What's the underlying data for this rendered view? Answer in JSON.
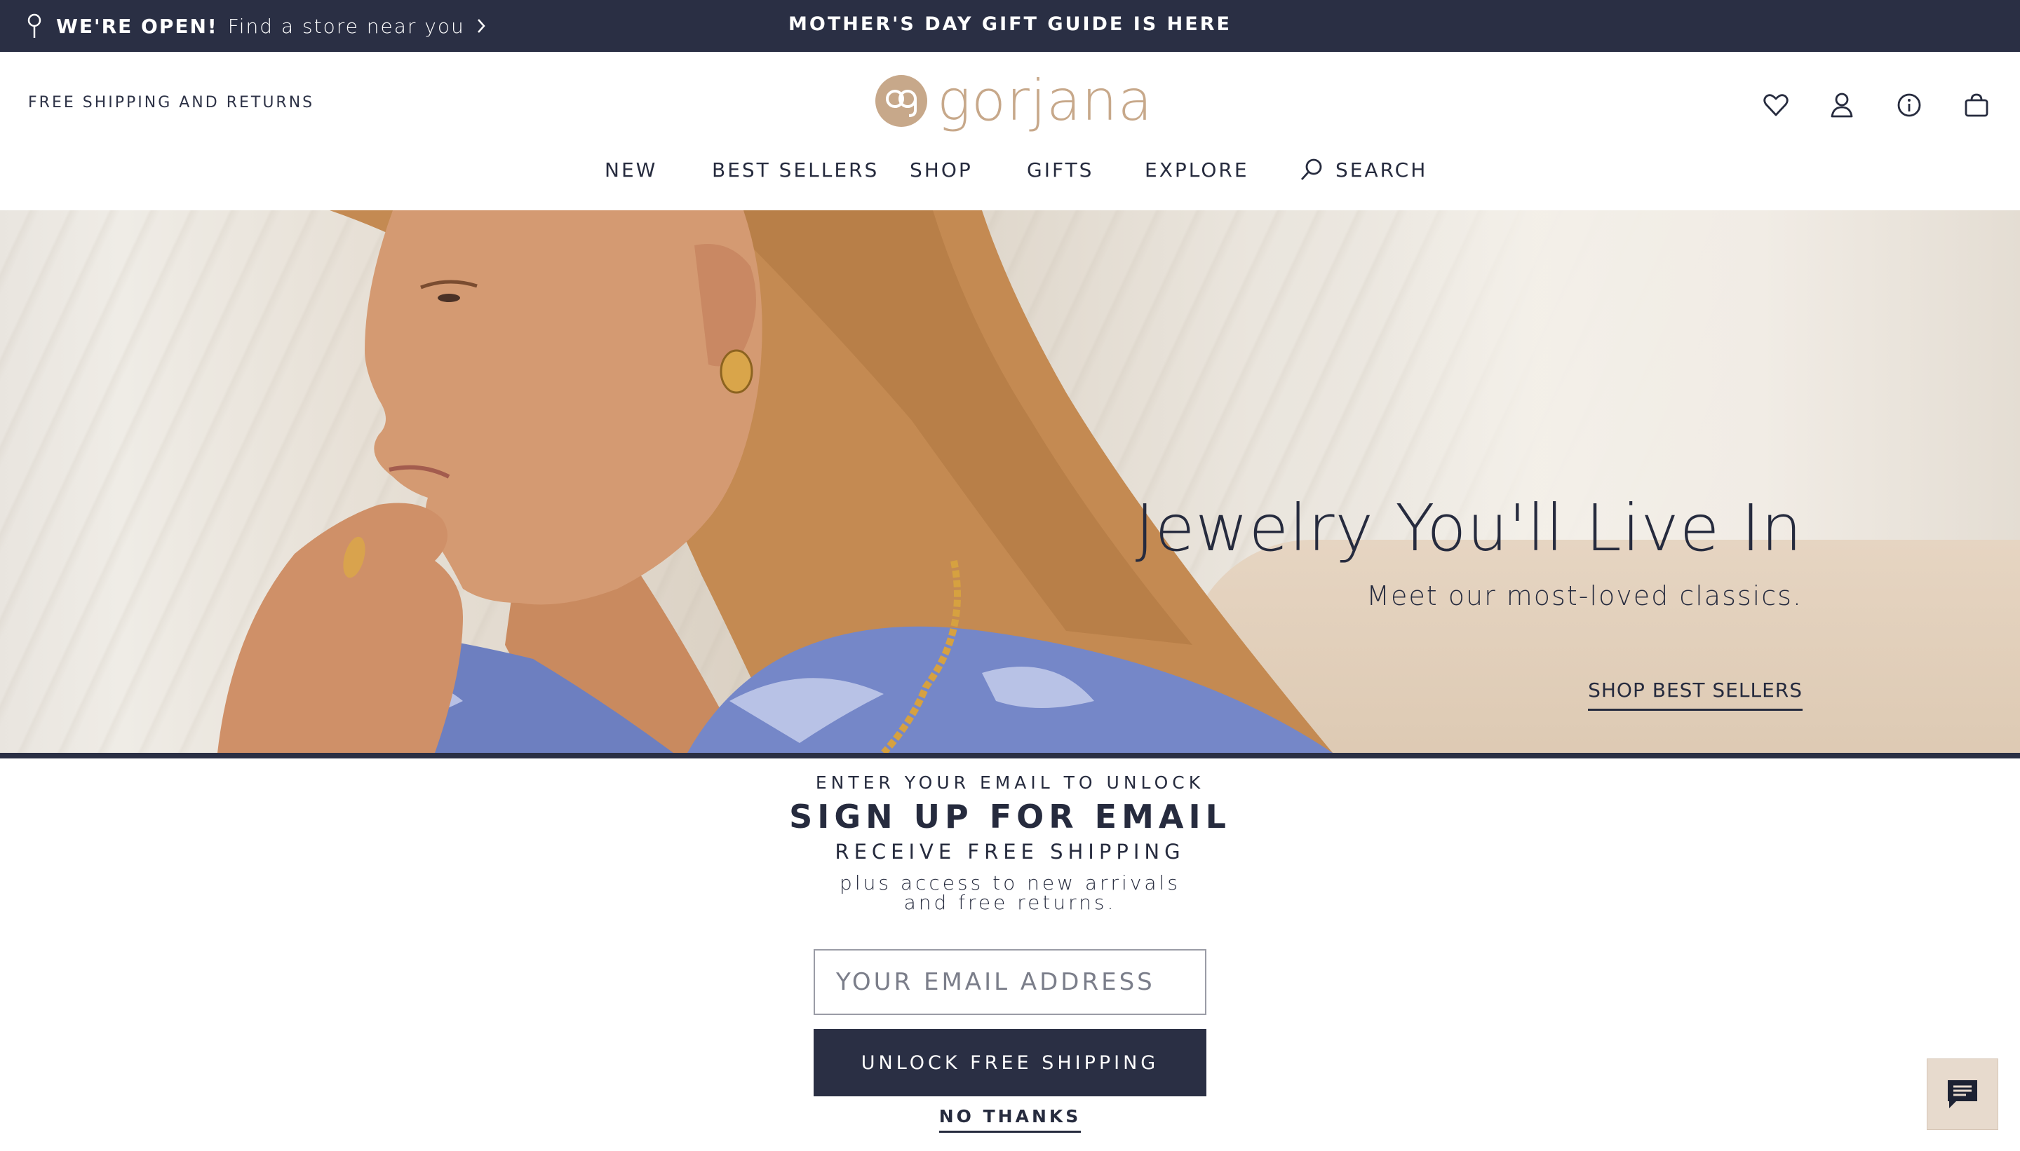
{
  "announcement": {
    "open_label": "WE'RE OPEN!",
    "find_store": "Find a store near you",
    "center_promo": "MOTHER'S DAY GIFT GUIDE IS HERE"
  },
  "header": {
    "free_shipping": "FREE SHIPPING AND RETURNS",
    "logo_text": "gorjana",
    "icons": [
      "heart-icon",
      "account-icon",
      "info-icon",
      "bag-icon"
    ]
  },
  "nav": {
    "items": [
      "NEW",
      "BEST SELLERS",
      "SHOP",
      "GIFTS",
      "EXPLORE"
    ],
    "search_label": "SEARCH"
  },
  "hero": {
    "title": "Jewelry You'll Live In",
    "subtitle": "Meet our most-loved classics.",
    "cta": "SHOP BEST SELLERS"
  },
  "signup": {
    "eyebrow": "ENTER YOUR EMAIL TO UNLOCK",
    "heading": "SIGN UP FOR EMAIL",
    "subheading": "RECEIVE FREE SHIPPING",
    "body_line1": "plus access to new arrivals",
    "body_line2": "and free returns.",
    "email_placeholder": "YOUR EMAIL ADDRESS",
    "submit_label": "UNLOCK FREE SHIPPING",
    "decline_label": "NO THANKS"
  },
  "colors": {
    "navy": "#2a2f44",
    "logo_gold": "#c7a88a",
    "chat_bg": "#e7dacd"
  }
}
